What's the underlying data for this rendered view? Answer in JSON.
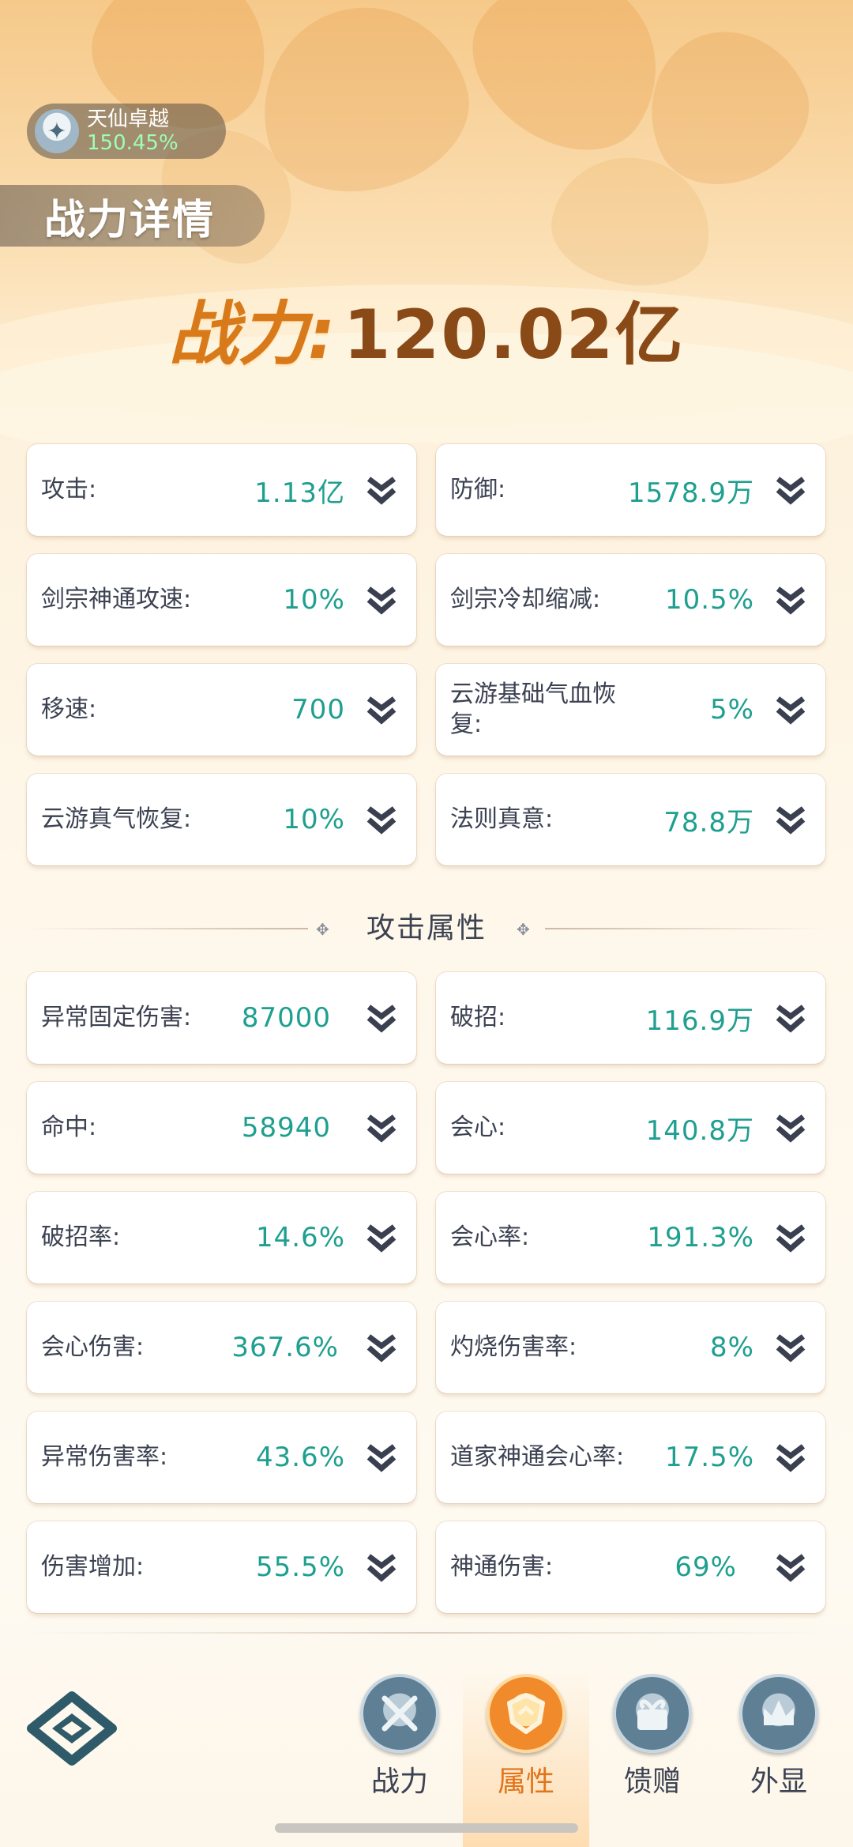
{
  "rank": {
    "title": "天仙卓越",
    "percent": "150.45%"
  },
  "page_title": "战力详情",
  "power": {
    "label": "战力:",
    "value": "120.02亿"
  },
  "base_stats": [
    {
      "label": "攻击:",
      "value": "1.13亿"
    },
    {
      "label": "防御:",
      "value": "1578.9万"
    },
    {
      "label": "剑宗神通攻速:",
      "value": "10%"
    },
    {
      "label": "剑宗冷却缩减:",
      "value": "10.5%"
    },
    {
      "label": "移速:",
      "value": "700"
    },
    {
      "label": "云游基础气血恢复:",
      "value": "5%"
    },
    {
      "label": "云游真气恢复:",
      "value": "10%"
    },
    {
      "label": "法则真意:",
      "value": "78.8万"
    }
  ],
  "attack_section": {
    "title": "攻击属性"
  },
  "attack_stats": [
    {
      "label": "异常固定伤害:",
      "value": "87000"
    },
    {
      "label": "破招:",
      "value": "116.9万"
    },
    {
      "label": "命中:",
      "value": "58940"
    },
    {
      "label": "会心:",
      "value": "140.8万"
    },
    {
      "label": "破招率:",
      "value": "14.6%"
    },
    {
      "label": "会心率:",
      "value": "191.3%"
    },
    {
      "label": "会心伤害:",
      "value": "367.6%"
    },
    {
      "label": "灼烧伤害率:",
      "value": "8%"
    },
    {
      "label": "异常伤害率:",
      "value": "43.6%"
    },
    {
      "label": "道家神通会心率:",
      "value": "17.5%"
    },
    {
      "label": "伤害增加:",
      "value": "55.5%"
    },
    {
      "label": "神通伤害:",
      "value": "69%"
    }
  ],
  "nav": {
    "items": [
      {
        "label": "战力",
        "icon": "crossed-swords-icon"
      },
      {
        "label": "属性",
        "icon": "shield-attribute-icon"
      },
      {
        "label": "馈赠",
        "icon": "gift-icon"
      },
      {
        "label": "外显",
        "icon": "appearance-crown-icon"
      }
    ],
    "active": "属性"
  },
  "colors": {
    "value_teal": "#1e9f8f",
    "power_orange": "#d97a1a",
    "active_nav": "#e2741a"
  }
}
